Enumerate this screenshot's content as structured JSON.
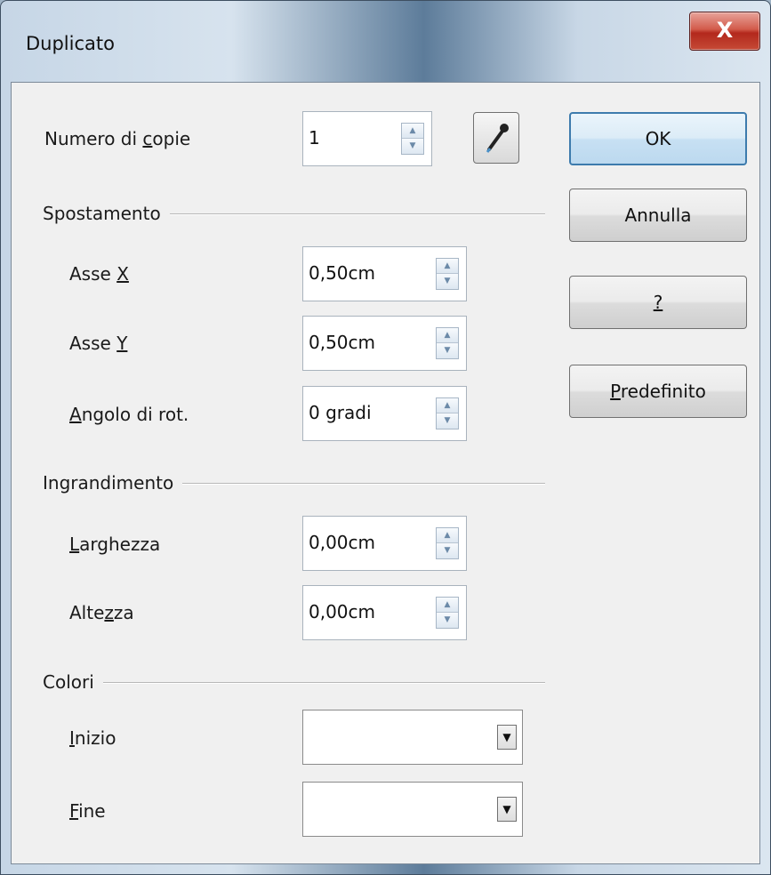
{
  "window": {
    "title": "Duplicato",
    "close_label": "X"
  },
  "copies": {
    "label_pre": "Numero di ",
    "label_u": "c",
    "label_post": "opie",
    "value": "1"
  },
  "sections": {
    "placement": "Spostamento",
    "enlargement": "Ingrandimento",
    "colors": "Colori"
  },
  "placement": {
    "x_axis": {
      "label_pre": "Asse ",
      "label_u": "X",
      "label_post": "",
      "value": "0,50cm"
    },
    "y_axis": {
      "label_pre": "Asse ",
      "label_u": "Y",
      "label_post": "",
      "value": "0,50cm"
    },
    "angle": {
      "label_pre": "",
      "label_u": "A",
      "label_post": "ngolo di rot.",
      "value": "0 gradi"
    }
  },
  "enlargement": {
    "width": {
      "label_pre": "",
      "label_u": "L",
      "label_post": "arghezza",
      "value": "0,00cm"
    },
    "height": {
      "label_pre": "Alte",
      "label_u": "z",
      "label_post": "za",
      "value": "0,00cm"
    }
  },
  "colors": {
    "start": {
      "label_pre": "",
      "label_u": "I",
      "label_post": "nizio",
      "value": ""
    },
    "end": {
      "label_pre": "",
      "label_u": "F",
      "label_post": "ine",
      "value": ""
    }
  },
  "buttons": {
    "ok": "OK",
    "cancel": "Annulla",
    "help": "?",
    "default_u": "P",
    "default_post": "redefinito"
  },
  "icons": {
    "pipette": "eyedropper-icon",
    "spin_up": "▲",
    "spin_down": "▼",
    "combo_arrow": "▼"
  }
}
